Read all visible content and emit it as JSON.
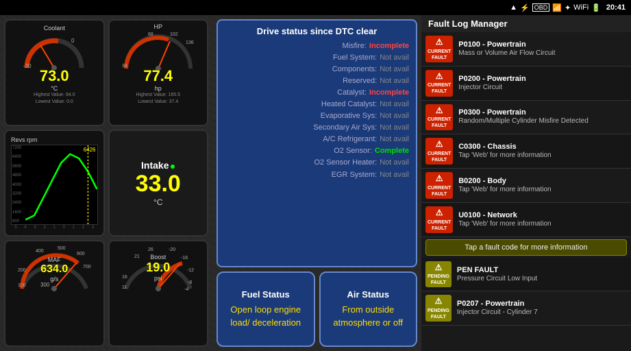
{
  "statusBar": {
    "time": "20:41",
    "icons": [
      "antenna",
      "usb",
      "obd",
      "signal",
      "bluetooth",
      "wifi",
      "battery"
    ]
  },
  "leftPanel": {
    "coolant": {
      "label": "Coolant",
      "value": "73.0",
      "unit": "°C",
      "rangeMin": "-30",
      "rangeMax": "0",
      "highestLabel": "Highest Value: 94.0",
      "lowestLabel": "Lowest Value: 0.0"
    },
    "hp": {
      "label": "HP",
      "value": "77.4",
      "unit": "hp",
      "rangeMin": "34",
      "rangeMax": "68",
      "rangeMax2": "102",
      "rangeMax3": "136",
      "highestLabel": "Highest Value: 165.5",
      "lowestLabel": "Lowest Value: 37.4"
    },
    "revs": {
      "label": "Revs rpm",
      "value": "6426",
      "scaleValues": [
        "7200",
        "6400",
        "5600",
        "4800",
        "4000",
        "3200",
        "2400",
        "1600",
        "800"
      ]
    },
    "intake": {
      "label": "Intake",
      "value": "33.0",
      "unit": "°C"
    },
    "maf": {
      "label": "MAF",
      "value": "634.0",
      "unit": "g/s",
      "rangeValues": [
        "400",
        "300",
        "200",
        "100",
        "500",
        "600",
        "700"
      ]
    },
    "boost": {
      "label": "Boost",
      "value": "19.0",
      "unit": "psi",
      "rangeValues": [
        "26",
        "21",
        "16",
        "11",
        "-20",
        "-16",
        "-12",
        "-8",
        "-4"
      ]
    }
  },
  "middlePanel": {
    "dtcTitle": "Drive status since DTC clear",
    "rows": [
      {
        "label": "Misfire:",
        "value": "Incomplete",
        "status": "incomplete"
      },
      {
        "label": "Fuel System:",
        "value": "Not avail",
        "status": "notavail"
      },
      {
        "label": "Components:",
        "value": "Not avail",
        "status": "notavail"
      },
      {
        "label": "Reserved:",
        "value": "Not avail",
        "status": "notavail"
      },
      {
        "label": "Catalyst:",
        "value": "Incomplete",
        "status": "incomplete"
      },
      {
        "label": "Heated Catalyst:",
        "value": "Not avail",
        "status": "notavail"
      },
      {
        "label": "Evaporative Sys:",
        "value": "Not avail",
        "status": "notavail"
      },
      {
        "label": "Secondary Air Sys:",
        "value": "Not avail",
        "status": "notavail"
      },
      {
        "label": "A/C Refrigerant:",
        "value": "Not avail",
        "status": "notavail"
      },
      {
        "label": "O2 Sensor:",
        "value": "Complete",
        "status": "complete"
      },
      {
        "label": "O2 Sensor Heater:",
        "value": "Not avail",
        "status": "notavail"
      },
      {
        "label": "EGR System:",
        "value": "Not avail",
        "status": "notavail"
      }
    ],
    "fuelStatus": {
      "title": "Fuel Status",
      "value": "Open loop engine load/ deceleration"
    },
    "airStatus": {
      "title": "Air Status",
      "value": "From outside atmosphere or off"
    }
  },
  "rightPanel": {
    "header": "Fault Log Manager",
    "faults": [
      {
        "badge": "CURRENT\nFAULT",
        "code": "P0100 - Powertrain",
        "desc": "Mass or Volume Air Flow Circuit",
        "pending": false
      },
      {
        "badge": "CURRENT\nFAULT",
        "code": "P0200 - Powertrain",
        "desc": "Injector Circuit",
        "pending": false
      },
      {
        "badge": "CURRENT\nFAULT",
        "code": "P0300 - Powertrain",
        "desc": "Random/Multiple Cylinder Misfire\nDetected",
        "pending": false
      },
      {
        "badge": "CURRENT\nFAULT",
        "code": "C0300 - Chassis",
        "desc": "Tap 'Web' for more information",
        "pending": false
      },
      {
        "badge": "CURRENT\nFAULT",
        "code": "B0200 - Body",
        "desc": "Tap 'Web' for more information",
        "pending": false
      },
      {
        "badge": "CURRENT\nFAULT",
        "code": "U0100 - Network",
        "desc": "Tap 'Web' for more information",
        "pending": false
      }
    ],
    "tapHint": "Tap a fault code for more information",
    "pendingFaults": [
      {
        "badge": "PENDING\nFAULT",
        "code": "PEN FAULT",
        "desc": "Pressure Circuit Low Input",
        "pending": true
      },
      {
        "badge": "PENDING\nFAULT",
        "code": "P0207 - Powertrain",
        "desc": "Injector Circuit - Cylinder 7",
        "pending": true
      }
    ]
  }
}
